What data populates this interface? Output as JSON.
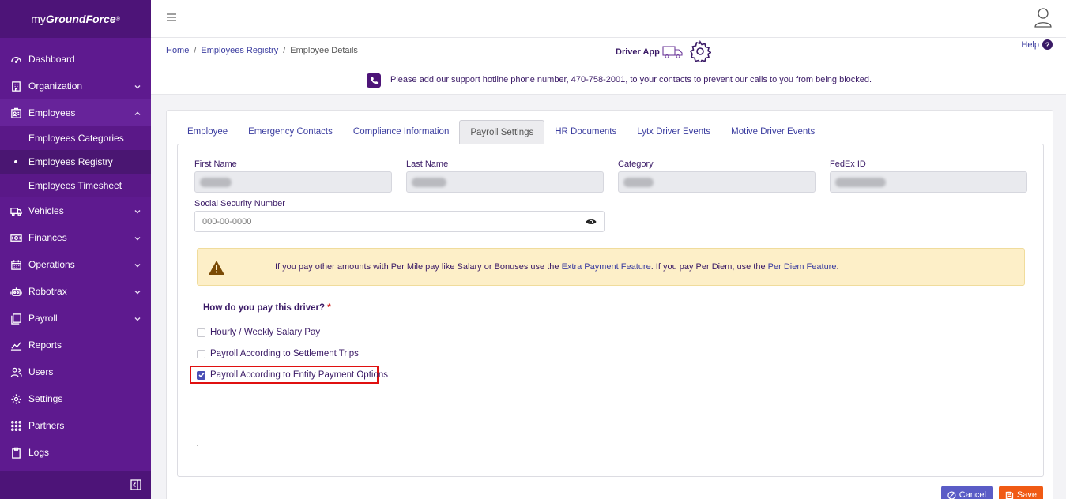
{
  "brand": {
    "prefix": "my",
    "name": "GroundForce",
    "mark": "®"
  },
  "sidebar": {
    "items": [
      {
        "label": "Dashboard",
        "icon": "dashboard-icon",
        "chevron": false
      },
      {
        "label": "Organization",
        "icon": "building-icon",
        "chevron": true
      },
      {
        "label": "Employees",
        "icon": "id-card-icon",
        "chevron": true,
        "open": true
      }
    ],
    "employees_sub": [
      {
        "label": "Employees Categories"
      },
      {
        "label": "Employees Registry",
        "active": true
      },
      {
        "label": "Employees Timesheet"
      }
    ],
    "items2": [
      {
        "label": "Vehicles",
        "icon": "truck-icon"
      },
      {
        "label": "Finances",
        "icon": "money-icon"
      },
      {
        "label": "Operations",
        "icon": "calendar-icon"
      },
      {
        "label": "Robotrax",
        "icon": "robot-icon"
      },
      {
        "label": "Payroll",
        "icon": "payroll-icon"
      },
      {
        "label": "Reports",
        "icon": "chart-icon"
      },
      {
        "label": "Users",
        "icon": "users-icon"
      },
      {
        "label": "Settings",
        "icon": "gear-icon"
      },
      {
        "label": "Partners",
        "icon": "grid-icon"
      },
      {
        "label": "Logs",
        "icon": "clipboard-icon"
      }
    ]
  },
  "breadcrumb": {
    "home": "Home",
    "registry": "Employees Registry",
    "current": "Employee Details",
    "sep": "/"
  },
  "driver_app": {
    "label": "Driver App"
  },
  "help": {
    "label": "Help",
    "icon_text": "?"
  },
  "notice": {
    "text": "Please add our support hotline phone number, 470-758-2001, to your contacts to prevent our calls to you from being blocked."
  },
  "tabs": [
    {
      "label": "Employee"
    },
    {
      "label": "Emergency Contacts"
    },
    {
      "label": "Compliance Information"
    },
    {
      "label": "Payroll Settings",
      "active": true
    },
    {
      "label": "HR Documents"
    },
    {
      "label": "Lytx Driver Events"
    },
    {
      "label": "Motive Driver Events"
    }
  ],
  "fields": {
    "first_name": "First Name",
    "last_name": "Last Name",
    "category": "Category",
    "fedex_id": "FedEx ID",
    "ssn_label": "Social Security Number",
    "ssn_placeholder": "000-00-0000"
  },
  "alert": {
    "text1": "If you pay other amounts with Per Mile pay like Salary or Bonuses use the ",
    "link1": "Extra Payment Feature",
    "text2": ". If you pay Per Diem, use the ",
    "link2": "Per Diem Feature",
    "text3": "."
  },
  "question": {
    "label": "How do you pay this driver?",
    "required": "*"
  },
  "options": [
    {
      "label": "Hourly / Weekly Salary Pay",
      "checked": false
    },
    {
      "label": "Payroll According to Settlement Trips",
      "checked": false
    },
    {
      "label": "Payroll According to Entity Payment Options",
      "checked": true
    }
  ],
  "buttons": {
    "cancel": "Cancel",
    "save": "Save"
  },
  "colors": {
    "sidebar": "#5e1a8f",
    "accent": "#3a1a66",
    "link": "#3c3ea0",
    "save": "#f05a14",
    "cancel": "#5a5cc6",
    "highlight": "#e01010"
  }
}
